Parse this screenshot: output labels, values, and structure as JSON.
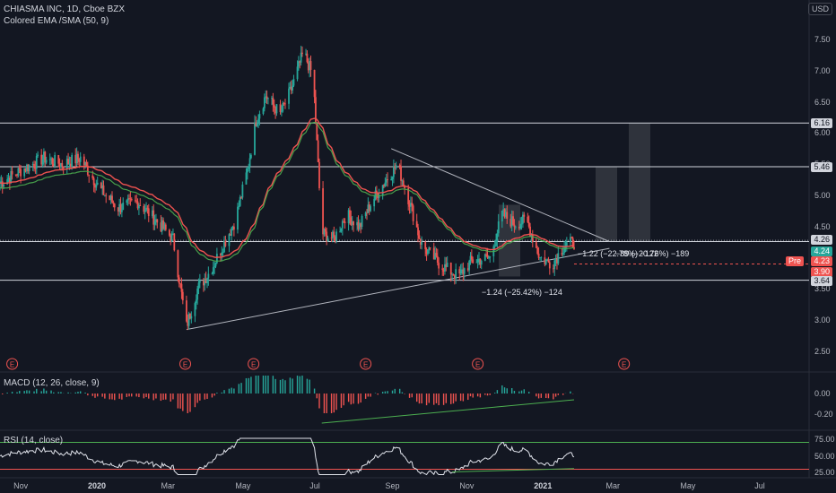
{
  "header": {
    "title": "CHIASMA INC, 1D, Cboe BZX",
    "indicator": "Colored EMA /SMA (50, 9)",
    "currency": "USD"
  },
  "macd": {
    "label": "MACD (12, 26, close, 9)",
    "ticks": [
      "0.00",
      "-0.20"
    ]
  },
  "rsi": {
    "label": "RSI (14, close)",
    "ticks": [
      "75.00",
      "50.00",
      "25.00"
    ]
  },
  "price_axis_ticks": [
    "7.50",
    "7.00",
    "6.50",
    "6.00",
    "5.50",
    "5.00",
    "4.50",
    "4.00",
    "3.50",
    "3.00",
    "2.50"
  ],
  "price_boxes": [
    {
      "text": "6.16",
      "kind": "level"
    },
    {
      "text": "5.46",
      "kind": "level"
    },
    {
      "text": "4.26",
      "kind": "level"
    },
    {
      "text": "4.24",
      "kind": "green"
    },
    {
      "text": "4.23",
      "kind": "red"
    },
    {
      "text": "3.90",
      "kind": "red"
    },
    {
      "text": "3.64",
      "kind": "level"
    }
  ],
  "pre_label": "Pre",
  "annotations": [
    {
      "text": "−1.24 (−25.42%) −124"
    },
    {
      "text": "−1.22 (−22.78%) −122"
    },
    {
      "text": "−89 (−20.76%) −189"
    }
  ],
  "earnings_marker": "E",
  "x_axis_labels": [
    "Nov",
    "2020",
    "Mar",
    "May",
    "Jul",
    "Sep",
    "Nov",
    "2021",
    "Mar",
    "May",
    "Jul"
  ],
  "colors": {
    "background": "#131722",
    "up": "#26a69a",
    "down": "#ef5350",
    "ema": "#ef5350",
    "sma": "#4caf50",
    "level": "#d1d4dc"
  },
  "chart_data": {
    "type": "candlestick",
    "symbol": "CHIASMA INC",
    "interval": "1D",
    "exchange": "Cboe BZX",
    "y_range": [
      2.2,
      7.9
    ],
    "horizontal_levels": [
      6.16,
      5.46,
      4.26,
      3.64
    ],
    "last_price": 4.24,
    "premarket_price": 4.23,
    "low_marker": 3.9,
    "triangle": {
      "upper": [
        [
          "2020-08-31",
          5.75
        ],
        [
          "2021-02-26",
          4.26
        ]
      ],
      "lower": [
        [
          "2020-03-16",
          2.85
        ],
        [
          "2021-02-26",
          4.15
        ]
      ]
    },
    "price_path": [
      [
        "2019-10-15",
        5.2
      ],
      [
        "2019-11-01",
        5.4
      ],
      [
        "2019-11-20",
        5.6
      ],
      [
        "2019-12-05",
        5.5
      ],
      [
        "2019-12-20",
        5.6
      ],
      [
        "2020-01-05",
        5.1
      ],
      [
        "2020-01-20",
        4.8
      ],
      [
        "2020-02-05",
        4.9
      ],
      [
        "2020-02-20",
        4.6
      ],
      [
        "2020-03-05",
        4.3
      ],
      [
        "2020-03-16",
        2.9
      ],
      [
        "2020-03-25",
        3.5
      ],
      [
        "2020-04-05",
        3.8
      ],
      [
        "2020-04-15",
        4.2
      ],
      [
        "2020-04-25",
        4.6
      ],
      [
        "2020-05-05",
        5.4
      ],
      [
        "2020-05-12",
        6.2
      ],
      [
        "2020-05-20",
        6.6
      ],
      [
        "2020-06-01",
        6.3
      ],
      [
        "2020-06-10",
        6.7
      ],
      [
        "2020-06-20",
        7.3
      ],
      [
        "2020-06-28",
        6.9
      ],
      [
        "2020-07-05",
        4.4
      ],
      [
        "2020-07-15",
        4.3
      ],
      [
        "2020-07-25",
        4.7
      ],
      [
        "2020-08-05",
        4.5
      ],
      [
        "2020-08-15",
        4.9
      ],
      [
        "2020-08-25",
        5.2
      ],
      [
        "2020-09-05",
        5.5
      ],
      [
        "2020-09-15",
        4.9
      ],
      [
        "2020-09-25",
        4.2
      ],
      [
        "2020-10-10",
        3.9
      ],
      [
        "2020-10-25",
        3.7
      ],
      [
        "2020-11-05",
        3.95
      ],
      [
        "2020-11-20",
        4.0
      ],
      [
        "2020-11-30",
        4.7
      ],
      [
        "2020-12-10",
        4.55
      ],
      [
        "2020-12-20",
        4.6
      ],
      [
        "2020-12-31",
        4.0
      ],
      [
        "2021-01-10",
        3.9
      ],
      [
        "2021-01-20",
        4.2
      ],
      [
        "2021-01-28",
        4.25
      ]
    ]
  }
}
